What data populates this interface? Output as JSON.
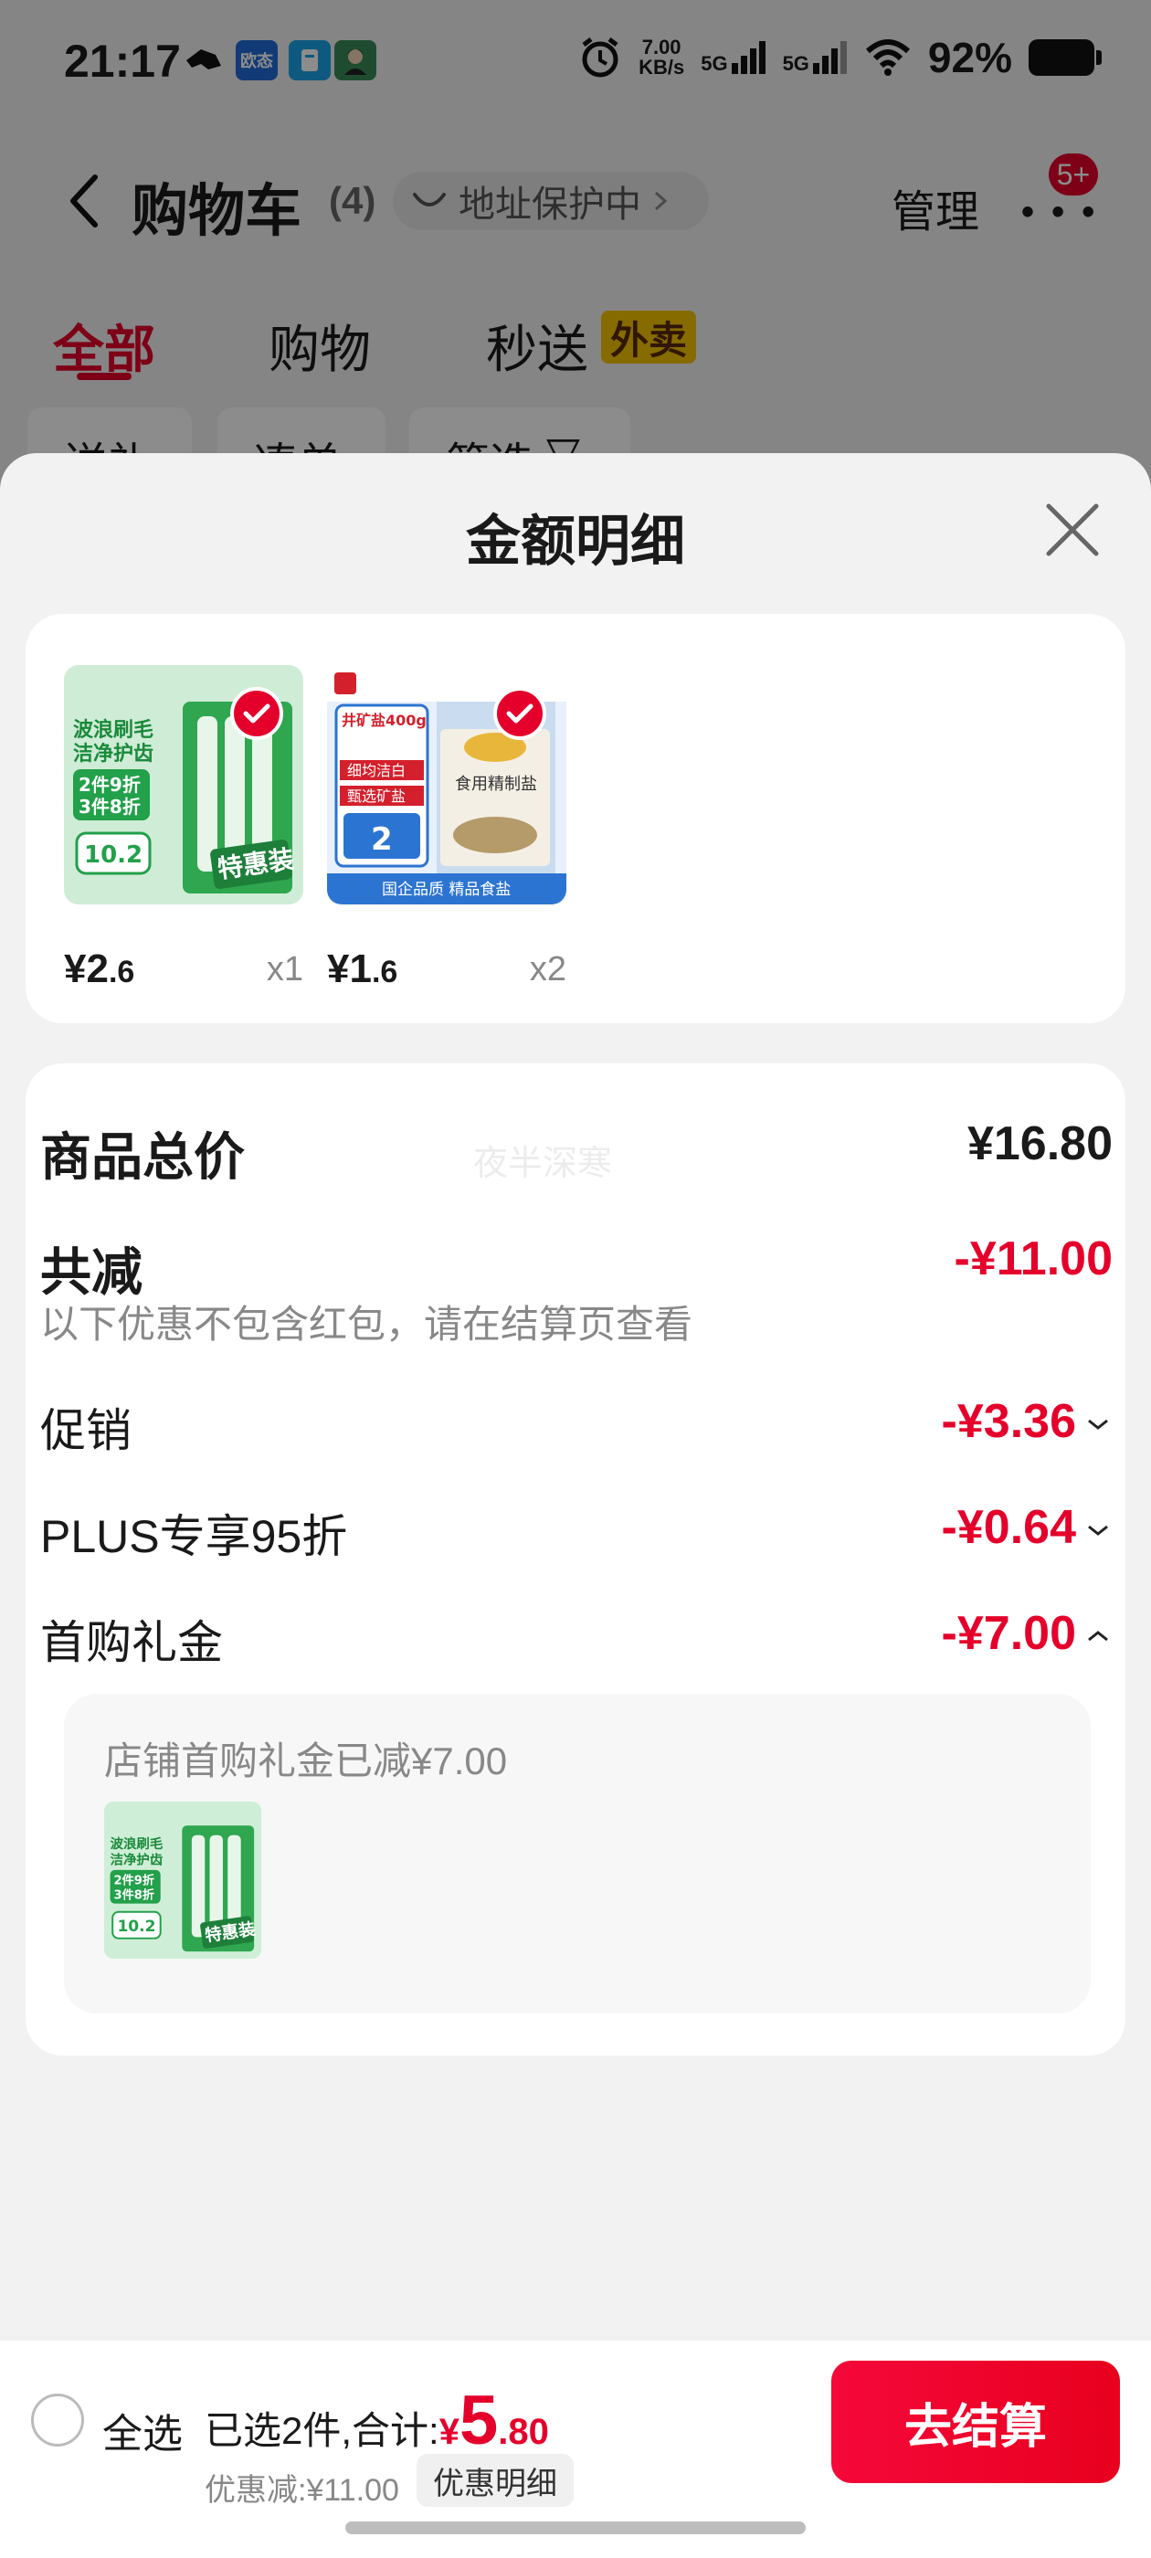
{
  "status_bar": {
    "time": "21:17",
    "app_icons": [
      "qq-icon",
      "oppo-icon",
      "notes-icon",
      "avatar-icon"
    ],
    "app_icon_labels": [
      "欧态"
    ],
    "net_speed_line1": "7.00",
    "net_speed_line2": "KB/s",
    "signal_1": "5G",
    "signal_2": "5G",
    "battery": "92%"
  },
  "header": {
    "title": "购物车",
    "count": "(4)",
    "address_protect": "地址保护中",
    "manage": "管理",
    "badge": "5+"
  },
  "tabs": [
    {
      "label": "全部",
      "active": true
    },
    {
      "label": "购物",
      "active": false
    },
    {
      "label": "秒送",
      "active": false
    }
  ],
  "tab_badge": "外卖",
  "chips": [
    "送礼",
    "凑单",
    "筛选"
  ],
  "sheet": {
    "title": "金额明细",
    "goods": [
      {
        "price_int": "¥2",
        "price_dec": ".6",
        "qty": "x1",
        "image": "toothbrush"
      },
      {
        "price_int": "¥1",
        "price_dec": ".6",
        "qty": "x2",
        "image": "salt"
      }
    ],
    "summary": {
      "total_label": "商品总价",
      "total_value": "¥16.80",
      "reduce_label": "共减",
      "reduce_value": "-¥11.00",
      "note": "以下优惠不包含红包，请在结算页查看",
      "watermark": "夜半深寒",
      "rows": [
        {
          "label": "促销",
          "value": "-¥3.36",
          "expanded": false
        },
        {
          "label": "PLUS专享95折",
          "value": "-¥0.64",
          "expanded": false
        },
        {
          "label": "首购礼金",
          "value": "-¥7.00",
          "expanded": true
        }
      ],
      "coupon_detail": "店铺首购礼金已减¥7.00"
    },
    "product_texts": {
      "toothbrush": {
        "l1": "波浪刷毛",
        "l2": "洁净护齿",
        "l3": "2件9折",
        "l4": "3件8折",
        "price": "10.2",
        "tag": "特惠装"
      },
      "salt": {
        "top": "井矿盐400g",
        "a": "细均洁白",
        "b": "甄选矿盐",
        "price": "2",
        "name": "食用精制盐",
        "banner": "国企品质 精品食盐"
      }
    }
  },
  "bottom_bar": {
    "select_all": "全选",
    "selected_text": "已选2件,合计:",
    "total_yen": "¥",
    "total_int": "5",
    "total_dec": ".80",
    "discount_text": "优惠减:¥11.00",
    "detail_button": "优惠明细",
    "checkout_button": "去结算"
  },
  "colors": {
    "accent": "#e4002b",
    "tab_badge": "#f5c400"
  }
}
